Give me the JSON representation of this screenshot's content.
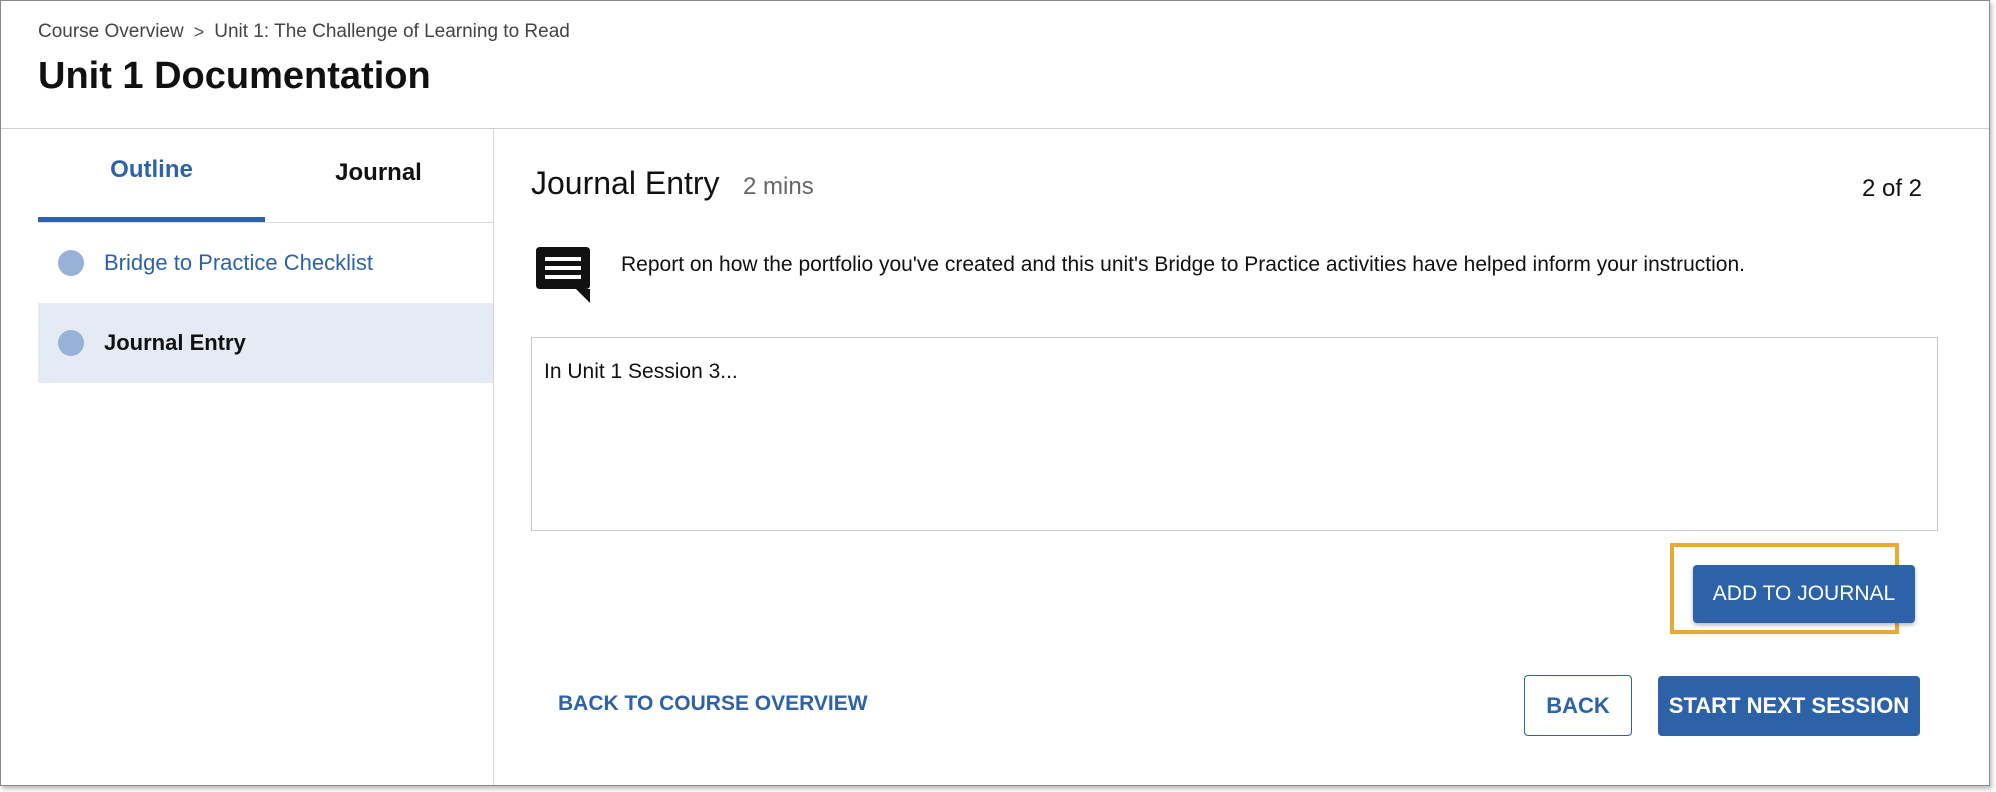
{
  "breadcrumb": {
    "items": [
      "Course Overview",
      "Unit 1: The Challenge of Learning to Read"
    ],
    "separator": ">"
  },
  "page_title": "Unit 1 Documentation",
  "sidebar": {
    "tabs": [
      {
        "label": "Outline",
        "active": true
      },
      {
        "label": "Journal",
        "active": false
      }
    ],
    "outline_items": [
      {
        "label": "Bridge to Practice Checklist",
        "selected": false
      },
      {
        "label": "Journal Entry",
        "selected": true
      }
    ]
  },
  "main": {
    "entry_title": "Journal Entry",
    "duration": "2 mins",
    "page_count": "2 of 2",
    "prompt_icon": "comment-icon",
    "prompt": "Report on how the portfolio you've created and this unit's Bridge to Practice activities have helped inform your instruction.",
    "journal_text": "In Unit 1 Session 3...",
    "add_to_journal_label": "ADD TO JOURNAL",
    "back_to_overview_label": "BACK TO COURSE OVERVIEW",
    "back_label": "BACK",
    "start_next_label": "START NEXT SESSION"
  },
  "colors": {
    "accent": "#2d62a8",
    "highlight": "#eaa934",
    "selected_bg": "#e4ebf5",
    "dot": "#97b2d6"
  }
}
